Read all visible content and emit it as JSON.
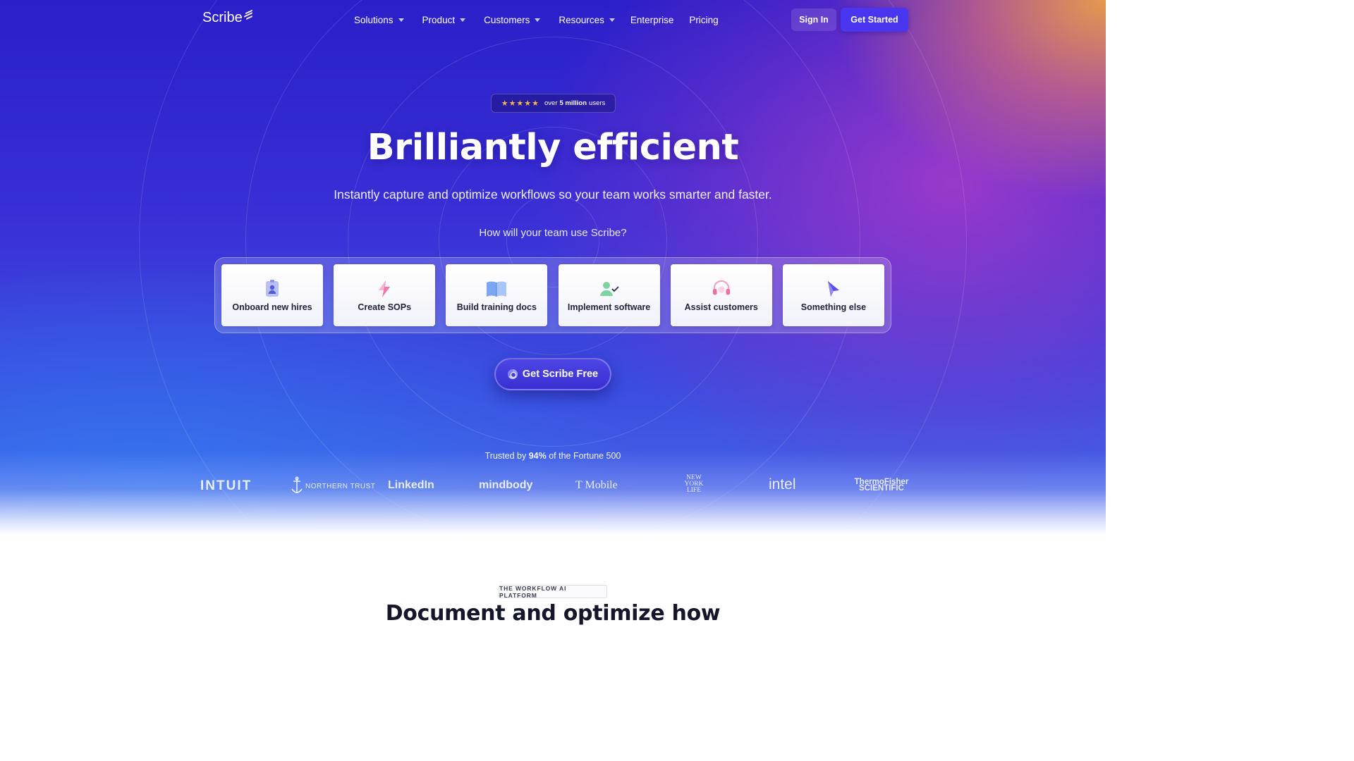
{
  "nav": {
    "logo": "Scribe",
    "items": [
      {
        "label": "Solutions",
        "dropdown": true
      },
      {
        "label": "Product",
        "dropdown": true
      },
      {
        "label": "Customers",
        "dropdown": true
      },
      {
        "label": "Resources",
        "dropdown": true
      },
      {
        "label": "Enterprise",
        "dropdown": false
      },
      {
        "label": "Pricing",
        "dropdown": false
      }
    ],
    "sign_in": "Sign In",
    "get_started": "Get Started"
  },
  "hero": {
    "rating": {
      "stars": "★★★★★",
      "prefix": "over",
      "count": "5 million",
      "suffix": "users"
    },
    "headline": "Brilliantly efficient",
    "subheadline": "Instantly capture and optimize workflows so your team works smarter and faster.",
    "question": "How will your team use Scribe?",
    "use_cases": [
      {
        "label": "Onboard new hires",
        "icon": "id-badge-icon"
      },
      {
        "label": "Create SOPs",
        "icon": "lightning-icon"
      },
      {
        "label": "Build training docs",
        "icon": "book-icon"
      },
      {
        "label": "Implement software",
        "icon": "user-check-icon"
      },
      {
        "label": "Assist customers",
        "icon": "headset-icon"
      },
      {
        "label": "Something else",
        "icon": "cursor-icon"
      }
    ],
    "cta": "Get Scribe Free",
    "cta_icon": "chrome-icon",
    "trusted": {
      "prefix": "Trusted by",
      "percent": "94%",
      "suffix": "of the Fortune 500"
    },
    "logos": [
      "INTUIT",
      "NORTHERN TRUST",
      "LinkedIn",
      "mindbody",
      "T Mobile",
      "NEW YORK LIFE",
      "intel",
      "ThermoFisher SCIENTIFIC"
    ]
  },
  "section": {
    "eyebrow": "THE WORKFLOW AI PLATFORM",
    "title": "Document and optimize how"
  },
  "colors": {
    "primary_button": "#4a36f0",
    "hero_top": "#2a1fc8",
    "hero_accent_orange": "#eea046",
    "hero_accent_purple": "#aa3cc8",
    "star": "#f9b53d"
  }
}
